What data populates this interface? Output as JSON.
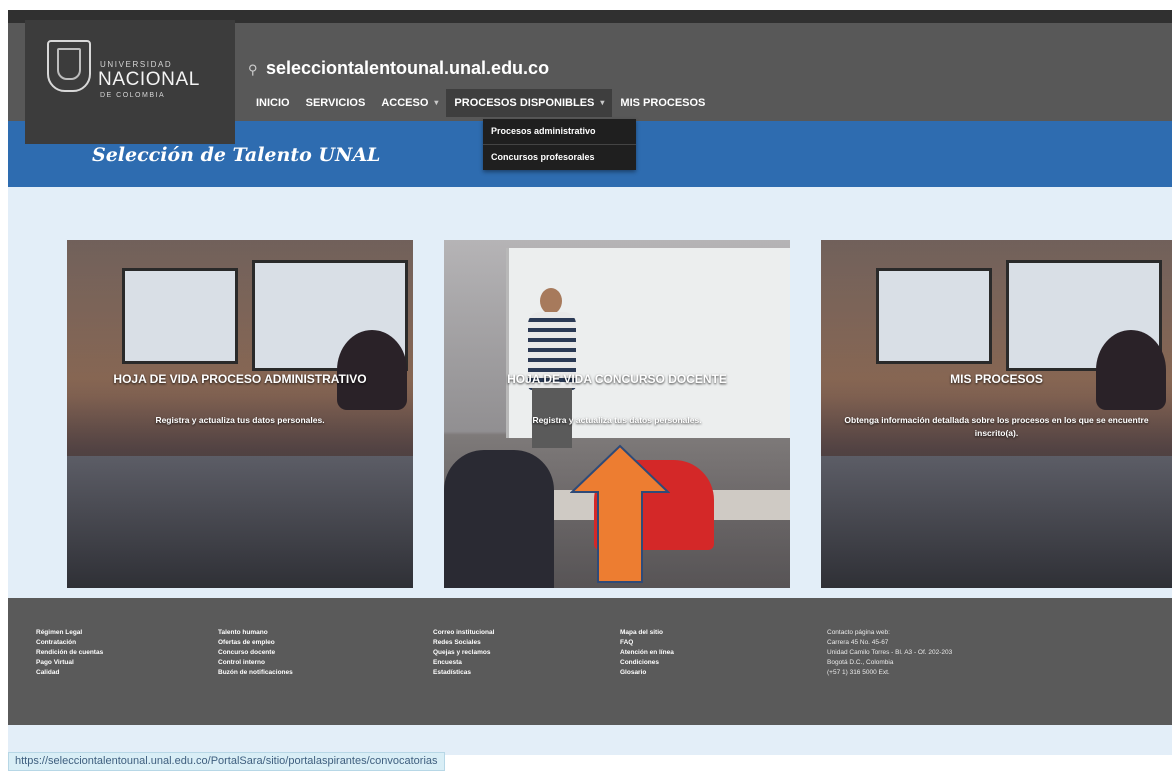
{
  "logo": {
    "line1": "UNIVERSIDAD",
    "line2": "NACIONAL",
    "line3": "DE COLOMBIA"
  },
  "header": {
    "domain": "seleccion­talentounal.unal.edu.co",
    "site_title": "Selección de Talento UNAL"
  },
  "nav": {
    "items": [
      {
        "label": "INICIO"
      },
      {
        "label": "SERVICIOS"
      },
      {
        "label": "ACCESO"
      },
      {
        "label": "PROCESOS DISPONIBLES"
      },
      {
        "label": "MIS PROCESOS"
      }
    ]
  },
  "dropdown": {
    "items": [
      {
        "label": "Procesos administrativo"
      },
      {
        "label": "Concursos profesorales"
      }
    ]
  },
  "cards": [
    {
      "title": "HOJA DE VIDA PROCESO ADMINISTRATIVO",
      "desc": "Registra y actualiza tus datos personales."
    },
    {
      "title": "HOJA DE VIDA CONCURSO DOCENTE",
      "desc": "Registra y actualiza tus datos personales."
    },
    {
      "title": "MIS PROCESOS",
      "desc": "Obtenga información detallada sobre los procesos en los que se encuentre inscrito(a)."
    }
  ],
  "footer": {
    "col1": [
      "Régimen Legal",
      "Contratación",
      "Rendición de cuentas",
      "Pago Virtual",
      "Calidad"
    ],
    "col2": [
      "Talento humano",
      "Ofertas de empleo",
      "Concurso docente",
      "Control interno",
      "Buzón de notificaciones"
    ],
    "col3": [
      "Correo institucional",
      "Redes Sociales",
      "Quejas y reclamos",
      "Encuesta",
      "Estadísticas"
    ],
    "col4": [
      "Mapa del sitio",
      "FAQ",
      "Atención en línea",
      "Condiciones",
      "Glosario"
    ],
    "col5": [
      "Contacto página web:",
      "Carrera 45 No. 45-67",
      "Unidad Camilo Torres - Bl. A3 - Of. 202-203",
      "Bogotá D.C., Colombia",
      "(+57 1) 316 5000 Ext."
    ]
  },
  "status_bar": {
    "url": "https://selecciontalentounal.unal.edu.co/PortalSara/sitio/portalaspirantes/convocatorias"
  },
  "colors": {
    "header_bg": "#585858",
    "blue_bar": "#2e6cb0",
    "arrow": "#ed7d31",
    "footer_bg": "#5a5a5a"
  }
}
